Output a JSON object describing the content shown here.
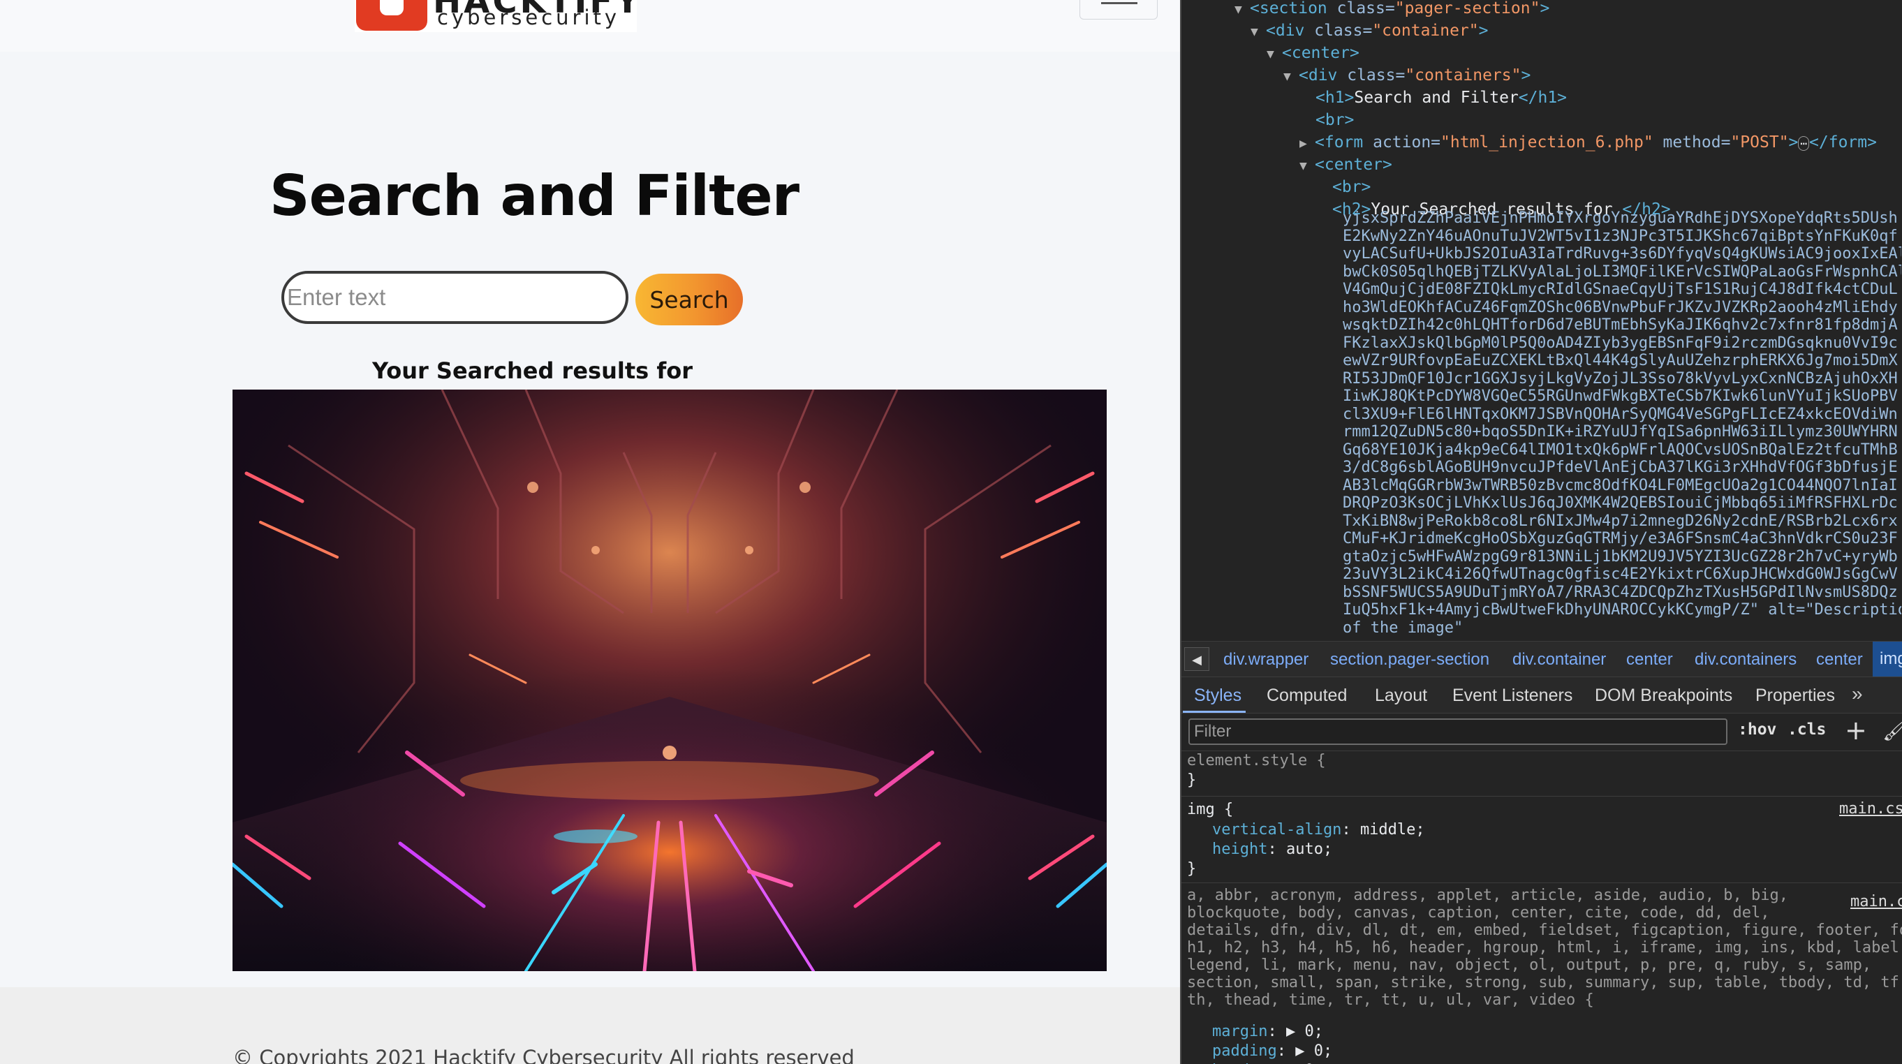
{
  "page": {
    "logo_word": "HACKTIFY",
    "logo_sub": "cybersecurity",
    "title": "Search and Filter",
    "search": {
      "placeholder": "Enter text",
      "button_label": "Search"
    },
    "results_heading": "Your Searched results for",
    "footer_text": "© Copyrights 2021 Hacktify Cybersecurity All rights reserved"
  },
  "devtools": {
    "tree": [
      {
        "open": "<section",
        "attr": " class=",
        "val": "\"pager-section\"",
        "close": ">"
      },
      {
        "open": "<div",
        "attr": " class=",
        "val": "\"container\"",
        "close": ">"
      },
      {
        "open": "<center",
        "attr": "",
        "val": "",
        "close": ">"
      },
      {
        "open": "<div",
        "attr": " class=",
        "val": "\"containers\"",
        "close": ">"
      },
      {
        "open": "<h1>",
        "text": "Search and Filter",
        "end": "</h1>"
      },
      {
        "open": "<br>"
      },
      {
        "open": "<form",
        "attr": " action=",
        "val": "\"html_injection_6.php\"",
        "attr2": " method=",
        "val2": "\"POST\"",
        "close": ">",
        "ellipsis": "⋯",
        "end": "</form>"
      },
      {
        "open": "<center",
        "attr": "",
        "val": "",
        "close": ">"
      },
      {
        "open": "<br>"
      },
      {
        "open": "<h2>",
        "text": "Your Searched results for ",
        "end": "</h2>"
      }
    ],
    "base64_lines": [
      "yjsxSprdZZhPaaiVEjnPHmoIYXrgoYnzyguaYRdhEjDYSXopeYdqRts5DUsh",
      "E2KwNy2ZnY46uAOnuTuJV2WT5vI1z3NJPc3T5IJKShc67qiBptsYnFKuK0qf",
      "vyLACSufU+UkbJS2OIuA3IaTrdRuvg+3s6DYfyqVsQ4gKUWsiAC9jooxIxEAl",
      "bwCk0S05qlhQEBjTZLKVyAlaLjoLI3MQFilKErVcSIWQPaLaoGsFrWspnhCAl",
      "V4GmQujCjdE08FZIQkLmycRIdlGSnaeCqyUjTsF1S1RujC4J8dIfk4ctCDuL",
      "ho3WldEOKhfACuZ46FqmZOShc06BVnwPbuFrJKZvJVZKRp2aooh4zMliEhdy",
      "wsqktDZIh42c0hLQHTforD6d7eBUTmEbhSyKaJIK6qhv2c7xfnr81fp8dmjA",
      "FKzlaxXJskQlbGpM0lP5Q0oAD4ZIyb3ygEBSnFqF9i2rczmDGsqknu0VvI9c",
      "ewVZr9URfovpEaEuZCXEKLtBxQl44K4gSlyAuUZehzrphERKX6Jg7moi5DmX",
      "RI53JDmQF10Jcr1GGXJsyjLkgVyZojJL3Sso78kVyvLyxCxnNCBzAjuhOxXH",
      "IiwKJ8QKtPcDYW8VGQeC55RGUnwdFWkgBXTeCSb7KIwk6lunVYuIjkSUoPBV",
      "cl3XU9+FlE6lHNTqxOKM7JSBVnQOHArSyQMG4VeSGPgFLIcEZ4xkcEOVdiWn",
      "rmm12QZuDN5c80+bqoS5DnIK+iRZYuUJfYqISa6pnHW63iILlymz30UWYHRN",
      "Gq68YE10JKja4kp9eC64lIMO1txQk6pWFrlAQOCvsUOSnBQalEz2tfcuTMhB",
      "3/dC8g6sblAGoBUH9nvcuJPfdeVlAnEjCbA37lKGi3rXHhdVfOGf3bDfusjE",
      "AB3lcMqGGRrbW3wTWRB50zBvcmc8OdfKO4LF0MEgcUOa2g1CO44NQO7lnIaI",
      "DRQPzO3KsOCjLVhKxlUsJ6qJ0XMK4W2QEBSIouiCjMbbq65iiMfRSFHXLrDc",
      "TxKiBN8wjPeRokb8co8Lr6NIxJMw4p7i2mnegD26Ny2cdnE/RSBrb2Lcx6rx",
      "CMuF+KJridmeKcgHoOSbXguzGqGTRMjy/e3A6FSnsmC4aC3hnVdkrCS0u23F",
      "gtaOzjc5wHFwAWzpgG9r813NNiLj1bKM2U9JV5YZI3UcGZ28r2h7vC+yryWb",
      "23uVY3L2ikC4i26QfwUTnagc0gfisc4E2YkixtrC6XupJHCWxdG0WJsGgCwV",
      "bSSNF5WUCS5A9UDuTjmRYoA7/RRA3C4ZDCQpZhzTXusH5GPdIlNvsmUS8DQz",
      "IuQ5hxF1k+4AmyjcBwUtweFkDhyUNAROCCykKCymgP/Z\" alt=\"Descriptio",
      "                       of the image\""
    ],
    "breadcrumbs": [
      "div.wrapper",
      "section.pager-section",
      "div.container",
      "center",
      "div.containers",
      "center",
      "img"
    ],
    "tabs": [
      "Styles",
      "Computed",
      "Layout",
      "Event Listeners",
      "DOM Breakpoints",
      "Properties",
      "»"
    ],
    "filter_placeholder": "Filter",
    "hov_label": ":hov",
    "cls_label": ".cls",
    "styles": {
      "element_style": "element.style {",
      "close_brace": "}",
      "img_selector": "img {",
      "img_source": "main.css",
      "img_props": [
        {
          "name": "vertical-align",
          "value": "middle;"
        },
        {
          "name": "height",
          "value": "auto;"
        }
      ],
      "reset_selector_lines": [
        "a, abbr, acronym, address, applet, article, aside, audio, b, big,",
        "blockquote, body, canvas, caption, center, cite, code, dd, del,",
        "details, dfn, div, dl, dt, em, embed, fieldset, figcaption, figure, footer, fo",
        "h1, h2, h3, h4, h5, h6, header, hgroup, html, i, iframe, img, ins, kbd, label",
        "legend, li, mark, menu, nav, object, ol, output, p, pre, q, ruby, s, samp,",
        "section, small, span, strike, strong, sub, summary, sup, table, tbody, td, tf",
        "th, thead, time, tr, tt, u, ul, var, video {"
      ],
      "reset_source": "main.css",
      "reset_props": [
        {
          "name": "margin",
          "value": "0;"
        },
        {
          "name": "padding",
          "value": "0;"
        },
        {
          "name": "border",
          "value": "0;"
        }
      ]
    }
  },
  "colors": {
    "accent_orange": "#f2962f",
    "devtools_bg": "#242424",
    "tag_blue": "#5db0d7",
    "attr_value": "#f29766"
  }
}
